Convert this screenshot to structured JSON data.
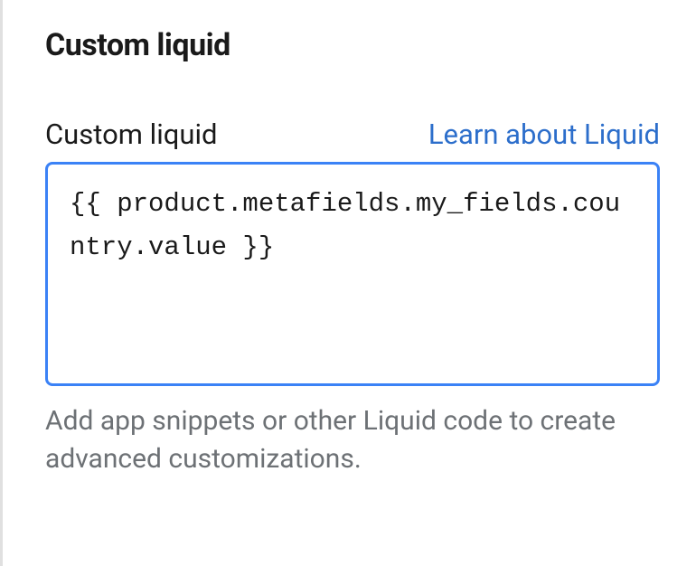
{
  "section": {
    "heading": "Custom liquid"
  },
  "field": {
    "label": "Custom liquid",
    "help_link": "Learn about Liquid",
    "value": "{{ product.metafields.my_fields.country.value }}",
    "help_text": "Add app snippets or other Liquid code to create advanced customizations."
  }
}
